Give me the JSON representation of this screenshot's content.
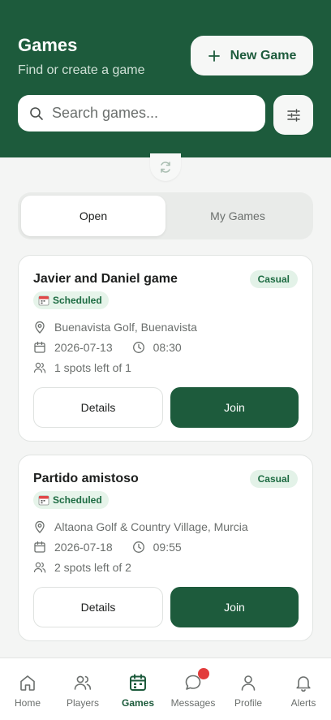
{
  "header": {
    "title": "Games",
    "subtitle": "Find or create a game",
    "new_game_label": "New Game"
  },
  "search": {
    "placeholder": "Search games...",
    "value": ""
  },
  "tabs": [
    {
      "label": "Open",
      "active": true
    },
    {
      "label": "My Games",
      "active": false
    }
  ],
  "games": [
    {
      "title": "Javier and Daniel game",
      "type_badge": "Casual",
      "status": "Scheduled",
      "location": "Buenavista Golf, Buenavista",
      "date": "2026-07-13",
      "time": "08:30",
      "spots": "1 spots left of 1",
      "details_label": "Details",
      "join_label": "Join"
    },
    {
      "title": "Partido amistoso",
      "type_badge": "Casual",
      "status": "Scheduled",
      "location": "Altaona Golf & Country Village, Murcia",
      "date": "2026-07-18",
      "time": "09:55",
      "spots": "2 spots left of 2",
      "details_label": "Details",
      "join_label": "Join"
    }
  ],
  "nav": [
    {
      "label": "Home",
      "icon": "home-icon"
    },
    {
      "label": "Players",
      "icon": "players-icon"
    },
    {
      "label": "Games",
      "icon": "calendar-icon",
      "active": true
    },
    {
      "label": "Messages",
      "icon": "message-icon",
      "has_notification": true
    },
    {
      "label": "Profile",
      "icon": "user-icon"
    },
    {
      "label": "Alerts",
      "icon": "bell-icon"
    }
  ],
  "colors": {
    "brand": "#1d5b3c",
    "badge_bg": "#e3f2e8",
    "notification": "#e23b3b"
  }
}
